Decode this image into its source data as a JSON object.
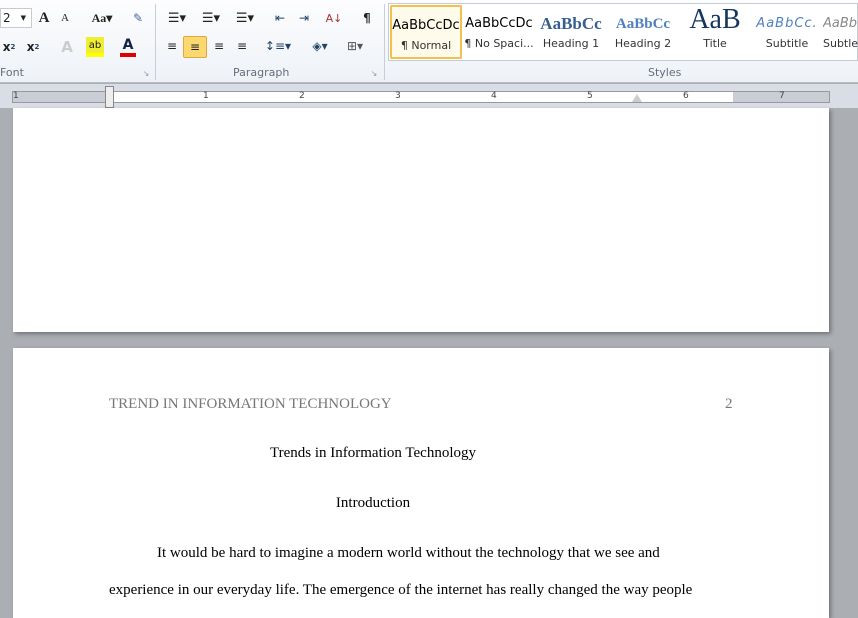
{
  "ribbon": {
    "font": {
      "size_value": "2",
      "label": "Font"
    },
    "paragraph": {
      "label": "Paragraph"
    },
    "styles": {
      "label": "Styles",
      "items": [
        {
          "preview": "AaBbCcDc",
          "name": "¶ Normal",
          "selected": true
        },
        {
          "preview": "AaBbCcDc",
          "name": "¶ No Spaci..."
        },
        {
          "preview": "AaBbCc",
          "name": "Heading 1"
        },
        {
          "preview": "AaBbCc",
          "name": "Heading 2"
        },
        {
          "preview": "AaB",
          "name": "Title"
        },
        {
          "preview": "AaBbCc.",
          "name": "Subtitle"
        },
        {
          "preview": "AaBb",
          "name": "Subtle"
        }
      ]
    },
    "colors": {
      "highlight": "#ffff00",
      "font_color": "#e00000",
      "selected": "#fbd970"
    }
  },
  "ruler": {
    "numbers": [
      "1",
      "1",
      "2",
      "3",
      "4",
      "5",
      "6",
      "7"
    ]
  },
  "document": {
    "header_text": "TREND IN INFORMATION TECHNOLOGY",
    "page_number": "2",
    "title": "Trends in Information Technology",
    "heading": "Introduction",
    "line1": "It would be hard to imagine a modern world without the technology that we see and",
    "line2": "experience in our everyday life. The emergence of the internet has really changed the way people"
  }
}
